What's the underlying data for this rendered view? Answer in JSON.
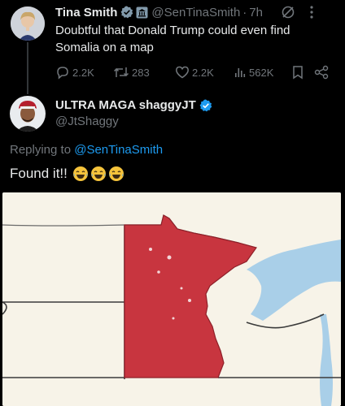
{
  "tweet1": {
    "author_name": "Tina Smith",
    "handle": "@SenTinaSmith",
    "separator": "·",
    "time": "7h",
    "text": "Doubtful that Donald Trump could even find Somalia on a map",
    "stats": {
      "replies": "2.2K",
      "retweets": "283",
      "likes": "2.2K",
      "views": "562K"
    }
  },
  "tweet2": {
    "author_name": "ULTRA MAGA shaggyJT",
    "handle": "@JtShaggy",
    "replying_prefix": "Replying to",
    "replying_to": "@SenTinaSmith",
    "text": "Found it!!"
  },
  "colors": {
    "accent": "#1d9bf0",
    "muted": "#71767b",
    "minnesota": "#c8353f",
    "land": "#f7f3e8",
    "water": "#a9cfe8"
  },
  "icons": [
    "verified-badge-icon",
    "government-badge-icon",
    "grok-icon",
    "more-icon",
    "reply-icon",
    "retweet-icon",
    "like-icon",
    "views-icon",
    "bookmark-icon",
    "share-icon",
    "laughing-emoji-icon"
  ]
}
